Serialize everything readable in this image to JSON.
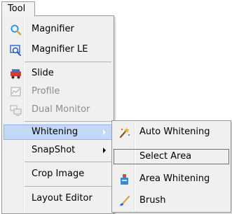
{
  "menubar": {
    "title": "Tool"
  },
  "main_menu": {
    "items": [
      {
        "label": "Magnifier",
        "icon": "magnifier-icon"
      },
      {
        "label": "Magnifier LE",
        "icon": "magnifier-le-icon"
      },
      {
        "label": "Slide",
        "icon": "slide-icon"
      },
      {
        "label": "Profile",
        "icon": "profile-icon",
        "disabled": true
      },
      {
        "label": "Dual Monitor",
        "icon": "dual-monitor-icon",
        "disabled": true
      },
      {
        "label": "Whitening",
        "has_submenu": true,
        "state": "open"
      },
      {
        "label": "SnapShot",
        "has_submenu": true
      },
      {
        "label": "Crop Image"
      },
      {
        "label": "Layout Editor"
      }
    ]
  },
  "sub_menu": {
    "items": [
      {
        "label": "Auto Whitening",
        "icon": "magic-wand-icon"
      },
      {
        "label": "Select Area",
        "state": "highlighted"
      },
      {
        "label": "Area Whitening",
        "icon": "area-whitening-icon"
      },
      {
        "label": "Brush",
        "icon": "brush-icon"
      }
    ]
  },
  "colors": {
    "highlight": "#c1d9f7",
    "menu_background": "#f0f0f0"
  }
}
